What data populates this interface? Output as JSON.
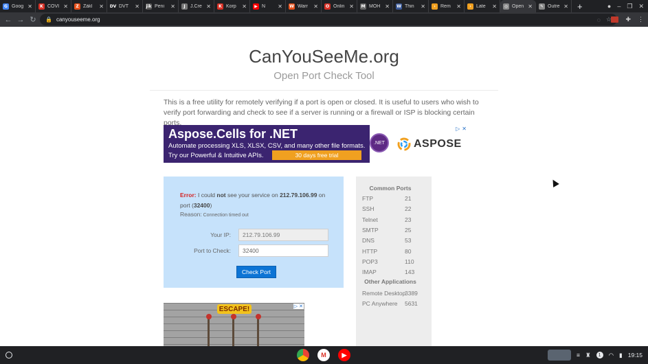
{
  "browser": {
    "tabs": [
      {
        "label": "Goog",
        "color": "#4285f4",
        "glyph": "G"
      },
      {
        "label": "COVI",
        "color": "#d93025",
        "glyph": "K"
      },
      {
        "label": "Zákl",
        "color": "#e8501a",
        "glyph": "Z"
      },
      {
        "label": "DVT",
        "color": "#202124",
        "glyph": "DV"
      },
      {
        "label": "Peni",
        "color": "#555555",
        "glyph": "jik"
      },
      {
        "label": "J.Cre",
        "color": "#777777",
        "glyph": "J"
      },
      {
        "label": "Korp",
        "color": "#d93025",
        "glyph": "K"
      },
      {
        "label": "N",
        "color": "#ff0000",
        "glyph": "▶"
      },
      {
        "label": "Warr",
        "color": "#e8501a",
        "glyph": "W"
      },
      {
        "label": "Onlin",
        "color": "#d93025",
        "glyph": "O"
      },
      {
        "label": "MOH",
        "color": "#666666",
        "glyph": "M"
      },
      {
        "label": "Thin",
        "color": "#3b5998",
        "glyph": "W"
      },
      {
        "label": "Rem",
        "color": "#f0a020",
        "glyph": "›"
      },
      {
        "label": "Late",
        "color": "#f0a020",
        "glyph": "›"
      },
      {
        "label": "Open",
        "color": "#888888",
        "glyph": "◎",
        "active": true
      },
      {
        "label": "Outre",
        "color": "#888888",
        "glyph": "✎"
      }
    ],
    "new_tab": "+",
    "url": "canyouseeme.org"
  },
  "page": {
    "title": "CanYouSeeMe.org",
    "subtitle": "Open Port Check Tool",
    "intro": "This is a free utility for remotely verifying if a port is open or closed. It is useful to users who wish to verify port forwarding and check to see if a server is running or a firewall or ISP is blocking certain ports."
  },
  "ad": {
    "title": "Aspose.Cells for .NET",
    "line1": "Automate processing XLS, XLSX, CSV, and many other file formats.",
    "line2": "Try our Powerful & Intuitive APIs.",
    "cta": "30 days free trial",
    "net_badge": ".NET",
    "brand": "ASPOSE"
  },
  "result": {
    "error_label": "Error:",
    "msg_a": " I could ",
    "msg_not": "not",
    "msg_b": " see your service on ",
    "ip": "212.79.106.99",
    "msg_c": " on port (",
    "port": "32400",
    "msg_d": ")",
    "reason_label": "Reason:",
    "reason_text": " Connection timed out"
  },
  "form": {
    "ip_label": "Your IP:",
    "ip_value": "212.79.106.99",
    "port_label": "Port to Check:",
    "port_value": "32400",
    "button": "Check Port"
  },
  "ports": {
    "heading": "Common Ports",
    "list": [
      {
        "name": "FTP",
        "port": "21"
      },
      {
        "name": "SSH",
        "port": "22"
      },
      {
        "name": "Telnet",
        "port": "23"
      },
      {
        "name": "SMTP",
        "port": "25"
      },
      {
        "name": "DNS",
        "port": "53"
      },
      {
        "name": "HTTP",
        "port": "80"
      },
      {
        "name": "POP3",
        "port": "110"
      },
      {
        "name": "IMAP",
        "port": "143"
      }
    ],
    "apps_heading": "Other Applications",
    "apps": [
      {
        "name": "Remote Desktop",
        "port": "3389"
      },
      {
        "name": "PC Anywhere",
        "port": "5631"
      }
    ]
  },
  "ad2": {
    "text": "ESCAPE!"
  },
  "taskbar": {
    "badge": "1",
    "time": "19:15"
  }
}
